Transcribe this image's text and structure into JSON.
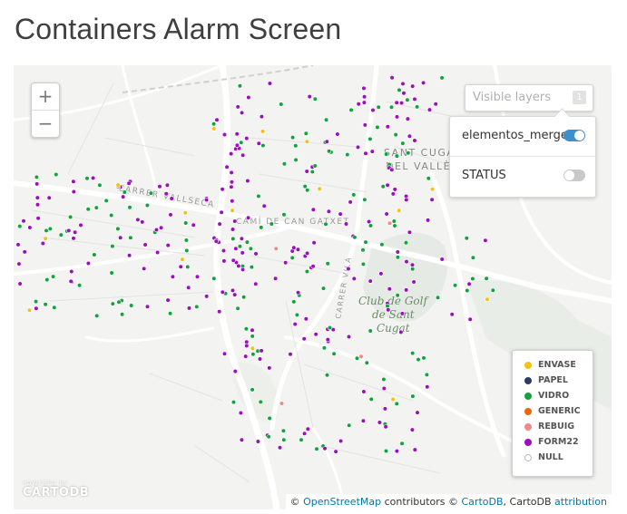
{
  "page": {
    "title": "Containers Alarm Screen"
  },
  "map": {
    "zoom": {
      "in_label": "+",
      "out_label": "−"
    },
    "layer_selector": {
      "button_label": "Visible layers",
      "count": "1",
      "layers": [
        {
          "name": "elementos_merge",
          "enabled": true
        },
        {
          "name": "STATUS",
          "enabled": false
        }
      ]
    },
    "legend": [
      {
        "label": "ENVASE",
        "color": "#f2c40f"
      },
      {
        "label": "PAPEL",
        "color": "#2c3e66"
      },
      {
        "label": "VIDRO",
        "color": "#12a33c"
      },
      {
        "label": "GENERIC",
        "color": "#e8670f"
      },
      {
        "label": "REBUIG",
        "color": "#f08a8a"
      },
      {
        "label": "FORM22",
        "color": "#9b0fbf"
      },
      {
        "label": "NULL",
        "color": "#ffffff"
      }
    ],
    "map_labels": [
      "CARRER VALLSECA",
      "CAMÍ DE CAN GATXET",
      "SANT CUGAT",
      "DEL VALLÈS",
      "Club de Golf",
      "de Sant",
      "Cugat",
      "CARRER VILA"
    ],
    "powered_by": {
      "line1": "POWERED BY",
      "line2": "CARTODB"
    },
    "attribution": {
      "prefix": "© ",
      "osm_link": "OpenStreetMap",
      "middle": " contributors © ",
      "cartodb_link": "CartoDB",
      "suffix": ", CartoDB ",
      "attribution_link": "attribution"
    }
  }
}
